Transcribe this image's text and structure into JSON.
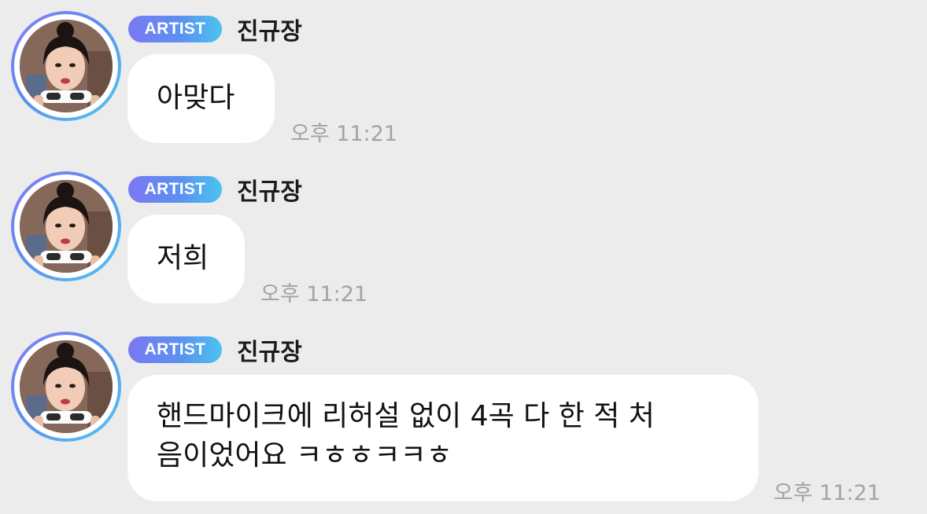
{
  "messages": [
    {
      "badge": "ARTIST",
      "sender": "진규장",
      "avatar_icon": "profile-photo",
      "text": "아맞다",
      "time": "오후 11:21"
    },
    {
      "badge": "ARTIST",
      "sender": "진규장",
      "avatar_icon": "profile-photo",
      "text": "저희",
      "time": "오후 11:21"
    },
    {
      "badge": "ARTIST",
      "sender": "진규장",
      "avatar_icon": "profile-photo",
      "text_line_1": "핸드마이크에 리허설 없이 4곡 다 한 적 처",
      "text_line_2": "음이었어요 ㅋㅎㅎㅋㅋㅎ",
      "time": "오후 11:21"
    }
  ],
  "colors": {
    "background": "#ececec",
    "bubble": "#ffffff",
    "badge_gradient_start": "#7a78f2",
    "badge_gradient_end": "#4dc3f0",
    "time_text": "#a3a3a3"
  }
}
